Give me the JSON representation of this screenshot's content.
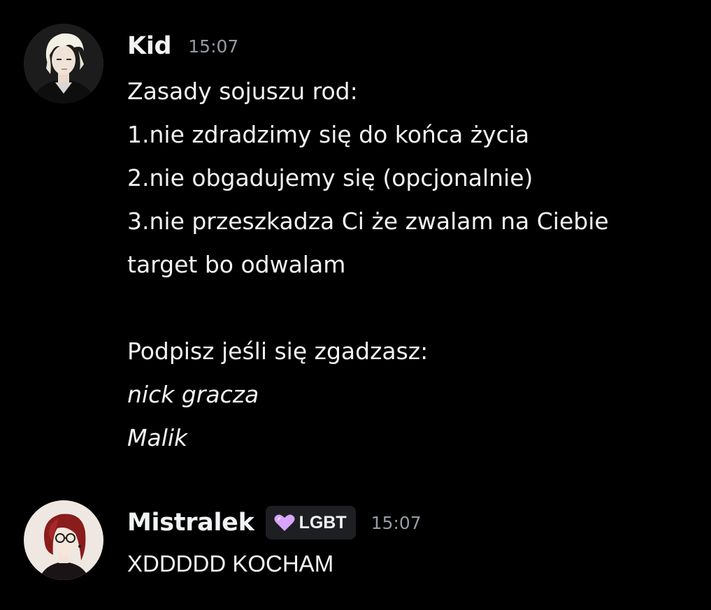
{
  "messages": [
    {
      "username": "Kid",
      "timestamp": "15:07",
      "lines": [
        "Zasady sojuszu rod:",
        "1.nie zdradzimy się do końca życia",
        "2.nie obgadujemy się (opcjonalnie)",
        "3.nie przeszkadza Ci że zwalam na Ciebie",
        "target bo odwalam",
        "",
        "Podpisz jeśli się zgadzasz:"
      ],
      "italic_lines": [
        "nick gracza",
        "Malik"
      ]
    },
    {
      "username": "Mistralek",
      "role": {
        "label": "LGBT",
        "icon": "pink-heart-icon",
        "color": "#d9a4ff"
      },
      "timestamp": "15:07",
      "text": "XDDDDD KOCHAM"
    }
  ],
  "colors": {
    "background": "#000000",
    "text": "#f2f3f5",
    "timestamp": "#949ba4",
    "role_tag_bg": "#1e1f22"
  }
}
